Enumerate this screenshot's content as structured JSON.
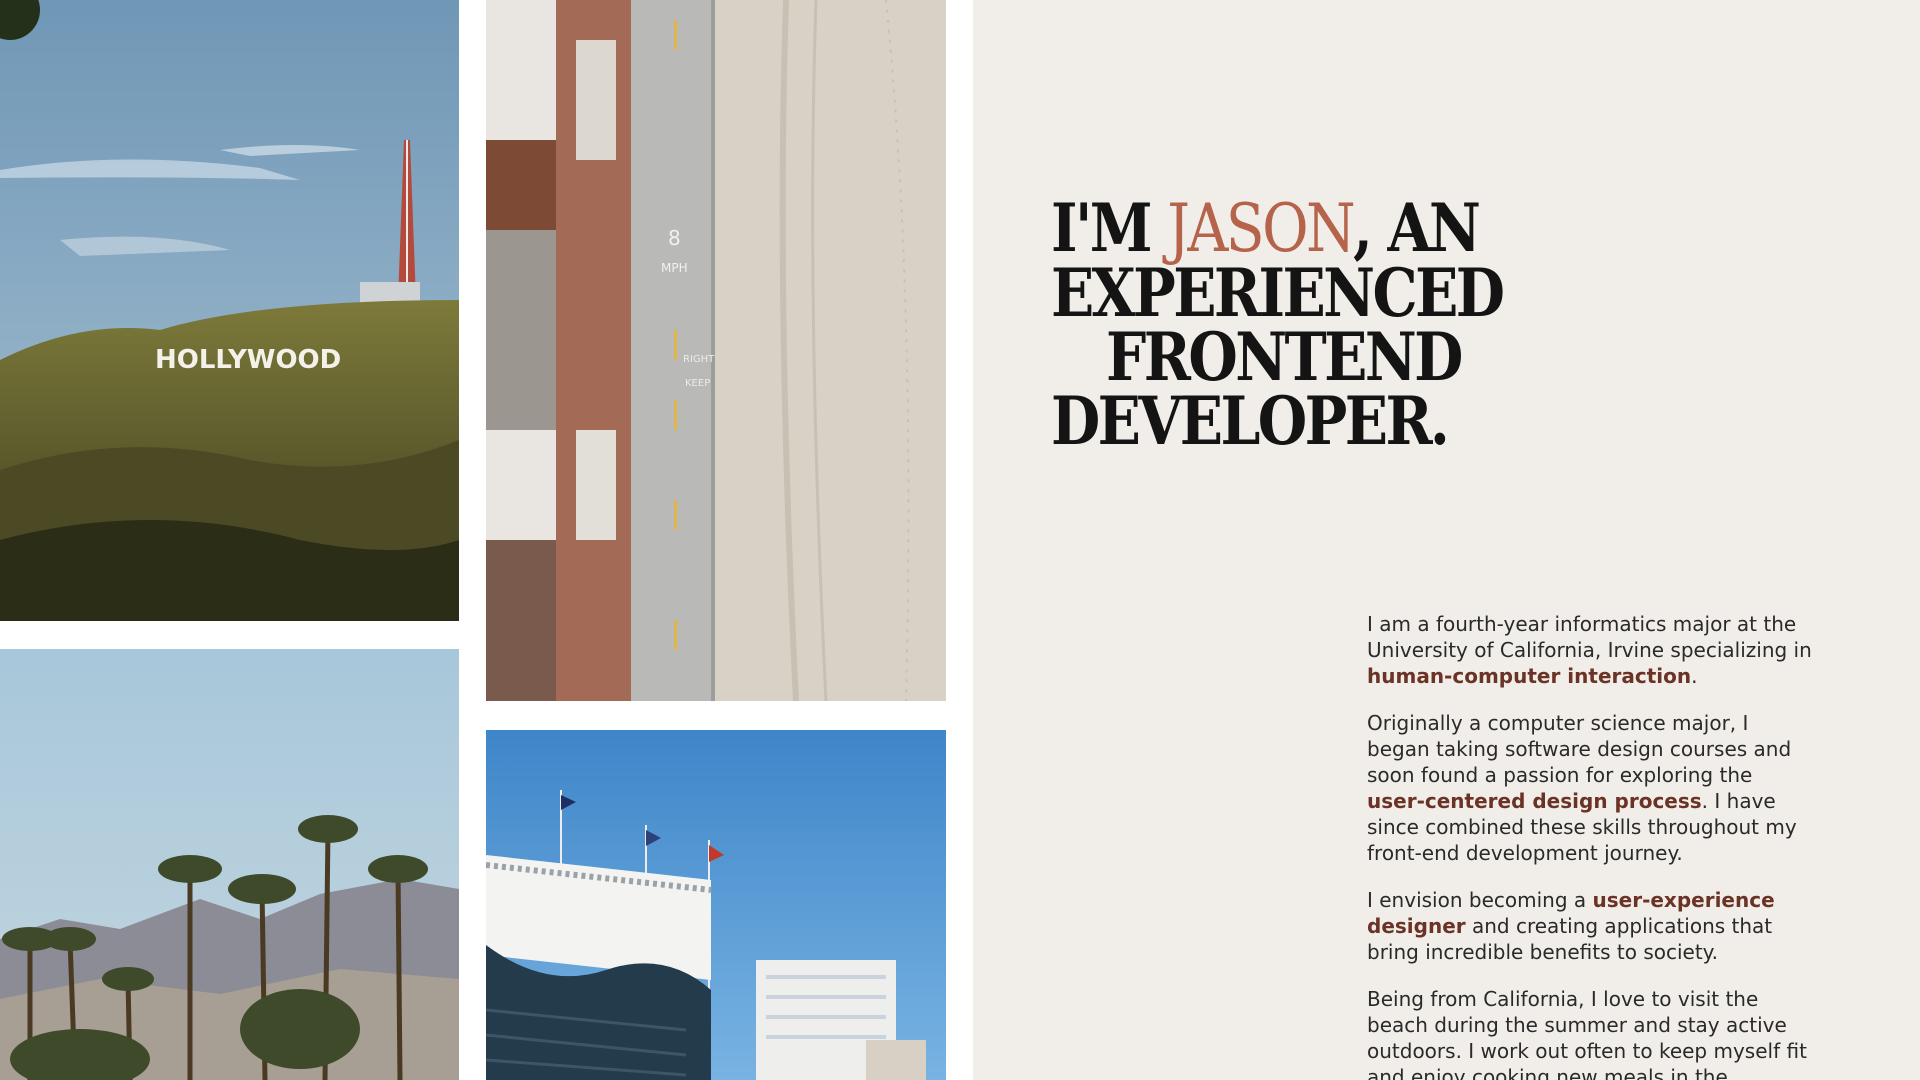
{
  "theme": {
    "panel_bg": "#f1eee9",
    "accent": "#b5634a",
    "highlight": "#6b3226",
    "text": "#2a2a2a",
    "heading": "#141414"
  },
  "hero": {
    "line1_pre": "I'M ",
    "name": "JASON",
    "line1_post": ", AN",
    "line2": "EXPERIENCED",
    "line3": "FRONTEND",
    "line4": "DEVELOPER."
  },
  "photos": {
    "hollywood": {
      "sign_text": "HOLLYWOOD"
    },
    "beach": {
      "road_speed": "8",
      "road_unit": "MPH",
      "road_text_1": "RIGHT",
      "road_text_2": "KEEP"
    },
    "stadium": {},
    "palms": {}
  },
  "bio": {
    "p1_a": "I am a fourth-year informatics major at the University of California, Irvine specializing in ",
    "p1_hl": "human-computer interaction",
    "p1_b": ".",
    "p2_a": "Originally a computer science major, I began taking software design courses and soon found a passion for exploring the ",
    "p2_hl": "user-centered design process",
    "p2_b": ". I have since combined these skills throughout my front-end development journey.",
    "p3_a": "I envision becoming a ",
    "p3_hl": "user-experience designer",
    "p3_b": " and creating applications that bring incredible benefits to society.",
    "p4_a": "Being from California, I love to visit the beach during the summer and stay active outdoors. I work out often to keep myself fit and enjoy cooking new meals in the"
  }
}
